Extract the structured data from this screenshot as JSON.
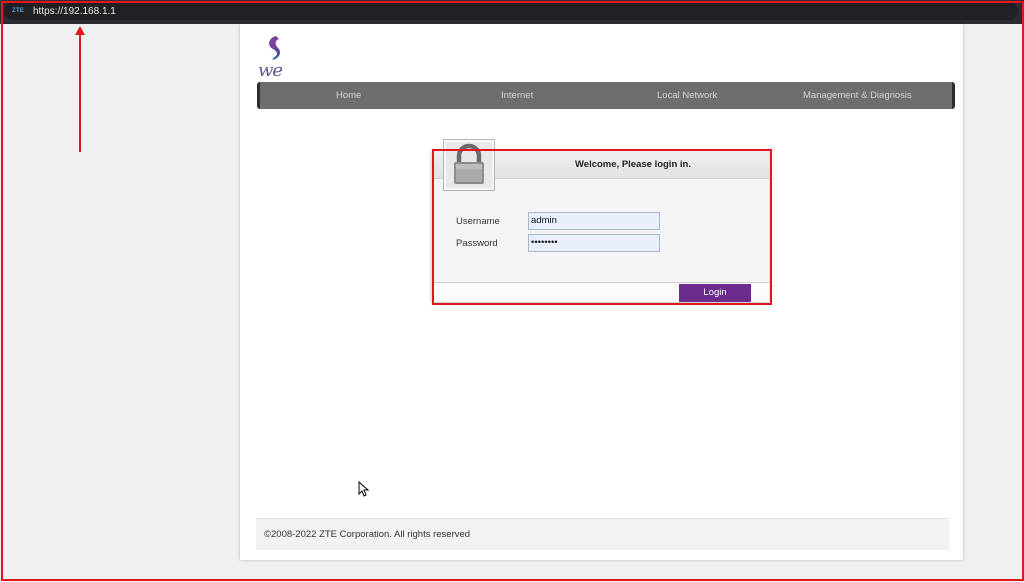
{
  "browser": {
    "favicon_text": "ZTE",
    "url": "https://192.168.1.1"
  },
  "brand": {
    "logo_text": "we",
    "logo_colors": [
      "#7b3fa0",
      "#2f5aa8"
    ]
  },
  "nav": {
    "items": [
      {
        "label": "Home"
      },
      {
        "label": "Internet"
      },
      {
        "label": "Local Network"
      },
      {
        "label": "Management & Diagnosis"
      }
    ]
  },
  "login": {
    "title": "Welcome, Please login in.",
    "username_label": "Username",
    "username_value": "admin",
    "password_label": "Password",
    "password_value": "••••••••",
    "button_label": "Login",
    "accent_color": "#6b2c8e"
  },
  "footer": {
    "copyright": "©2008-2022 ZTE Corporation. All rights reserved"
  },
  "annotation_color": "#e3161c",
  "icons": [
    "lock-icon",
    "mouse-cursor-icon",
    "red-arrow-icon"
  ]
}
